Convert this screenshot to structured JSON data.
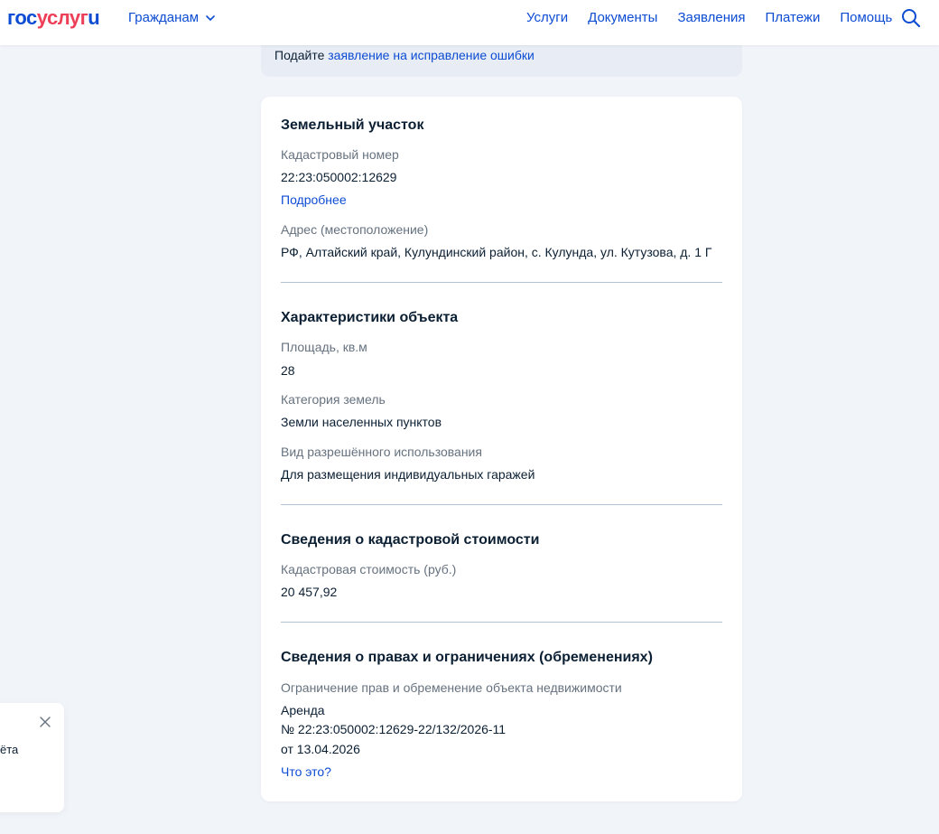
{
  "header": {
    "logo": {
      "part1": "гос",
      "part2": "услуг",
      "part3": "u"
    },
    "audience": "Гражданам",
    "nav": [
      "Услуги",
      "Документы",
      "Заявления",
      "Платежи",
      "Помощь"
    ],
    "icons": {
      "search": "search-icon",
      "dropdown": "chevron-down-icon"
    },
    "colors": {
      "brand_blue": "#0d4cd3",
      "brand_red": "#ee3f58"
    }
  },
  "notice": {
    "prefix": "Подайте",
    "link": "заявление на исправление ошибки"
  },
  "land": {
    "title": "Земельный участок",
    "cadastral_label": "Кадастровый номер",
    "cadastral_value": "22:23:050002:12629",
    "more_link": "Подробнее",
    "address_label": "Адрес (местоположение)",
    "address_value": "РФ, Алтайский край, Кулундинский район, с. Кулунда, ул. Кутузова, д. 1 Г"
  },
  "characteristics": {
    "title": "Характеристики объекта",
    "area_label": "Площадь, кв.м",
    "area_value": "28",
    "category_label": "Категория земель",
    "category_value": "Земли населенных пунктов",
    "usage_label": "Вид разрешённого использования",
    "usage_value": "Для размещения индивидуальных гаражей"
  },
  "cost": {
    "title": "Сведения о кадастровой стоимости",
    "cost_label": "Кадастровая стоимость (руб.)",
    "cost_value": "20 457,92"
  },
  "rights": {
    "title": "Сведения о правах и ограничениях (обременениях)",
    "restriction_label": "Ограничение прав и обременение объекта недвижимости",
    "line1": "Аренда",
    "line2": "№ 22:23:050002:12629-22/132/2026-11",
    "line3": "от 13.04.2026",
    "what_link": "Что это?"
  },
  "popup": {
    "text": "ёта",
    "icons": {
      "close": "close-icon"
    }
  }
}
